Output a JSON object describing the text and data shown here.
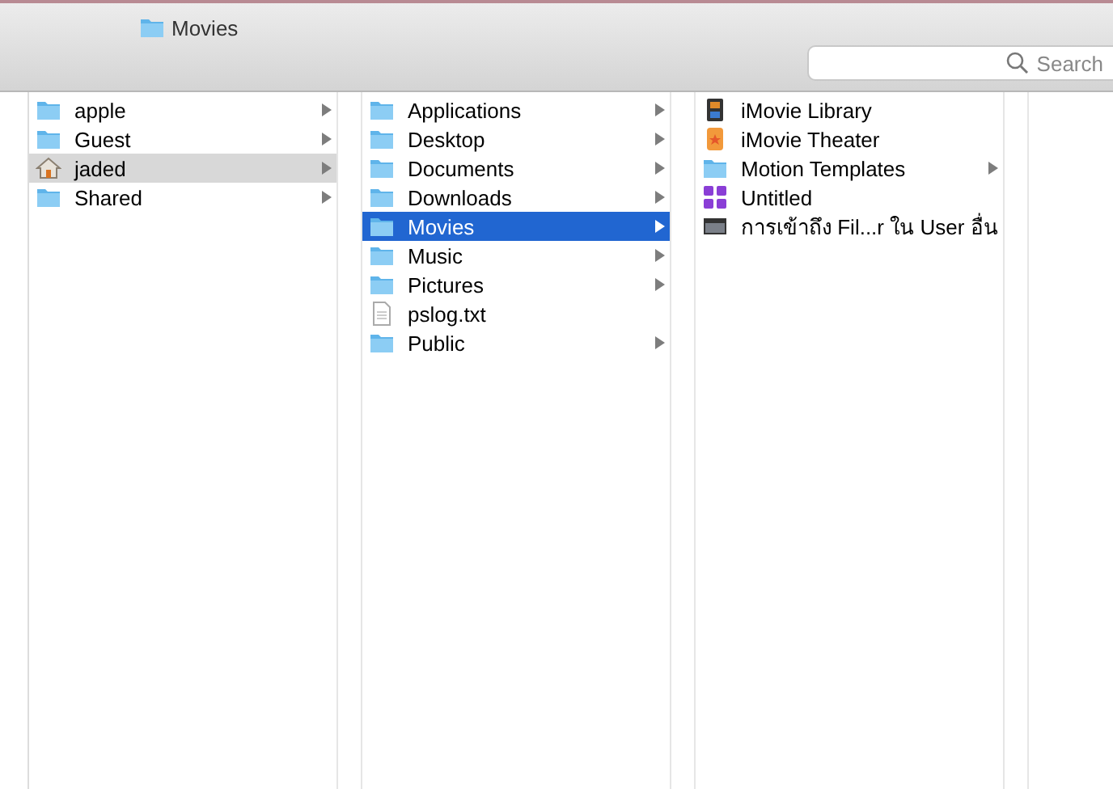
{
  "window": {
    "title": "Movies"
  },
  "search": {
    "placeholder": "Search"
  },
  "columns": [
    {
      "items": [
        {
          "name": "apple",
          "kind": "folder",
          "selected": false,
          "has_children": true
        },
        {
          "name": "Guest",
          "kind": "folder",
          "selected": false,
          "has_children": true
        },
        {
          "name": "jaded",
          "kind": "home",
          "selected": true,
          "has_children": true
        },
        {
          "name": "Shared",
          "kind": "folder",
          "selected": false,
          "has_children": true
        }
      ]
    },
    {
      "items": [
        {
          "name": "Applications",
          "kind": "folder",
          "selected": false,
          "has_children": true
        },
        {
          "name": "Desktop",
          "kind": "folder",
          "selected": false,
          "has_children": true
        },
        {
          "name": "Documents",
          "kind": "folder",
          "selected": false,
          "has_children": true
        },
        {
          "name": "Downloads",
          "kind": "folder",
          "selected": false,
          "has_children": true
        },
        {
          "name": "Movies",
          "kind": "folder",
          "selected": true,
          "has_children": true
        },
        {
          "name": "Music",
          "kind": "folder",
          "selected": false,
          "has_children": true
        },
        {
          "name": "Pictures",
          "kind": "folder",
          "selected": false,
          "has_children": true
        },
        {
          "name": "pslog.txt",
          "kind": "file",
          "selected": false,
          "has_children": false
        },
        {
          "name": "Public",
          "kind": "folder",
          "selected": false,
          "has_children": true
        }
      ]
    },
    {
      "items": [
        {
          "name": "iMovie Library",
          "kind": "library",
          "selected": false,
          "has_children": false
        },
        {
          "name": "iMovie Theater",
          "kind": "theater",
          "selected": false,
          "has_children": false
        },
        {
          "name": "Motion Templates",
          "kind": "folder",
          "selected": false,
          "has_children": true
        },
        {
          "name": "Untitled",
          "kind": "app",
          "selected": false,
          "has_children": false
        },
        {
          "name": "การเข้าถึง Fil...r ใน User อื่น",
          "kind": "alias",
          "selected": false,
          "has_children": false
        }
      ]
    }
  ]
}
